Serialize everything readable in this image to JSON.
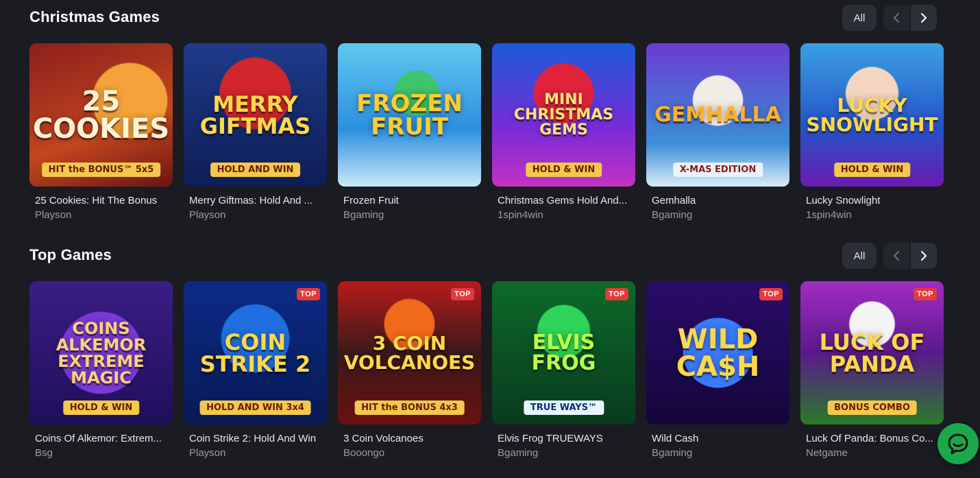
{
  "sections": [
    {
      "title": "Christmas Games",
      "all_label": "All",
      "games": [
        {
          "name": "25 Cookies: Hit The Bonus",
          "provider": "Playson",
          "art_title": "25\nCookies",
          "art_sub": "HIT the BONUS™ 5x5",
          "badge": ""
        },
        {
          "name": "Merry Giftmas: Hold And ...",
          "provider": "Playson",
          "art_title": "Merry\nGiftmas",
          "art_sub": "HOLD AND WIN",
          "badge": ""
        },
        {
          "name": "Frozen Fruit",
          "provider": "Bgaming",
          "art_title": "Frozen\nFruit",
          "art_sub": "",
          "badge": ""
        },
        {
          "name": "Christmas Gems Hold And...",
          "provider": "1spin4win",
          "art_title": "Mini\nChristmas Gems",
          "art_sub": "HOLD & WIN",
          "badge": ""
        },
        {
          "name": "Gemhalla",
          "provider": "Bgaming",
          "art_title": "Gemhalla",
          "art_sub": "X-MAS EDITION",
          "badge": ""
        },
        {
          "name": "Lucky Snowlight",
          "provider": "1spin4win",
          "art_title": "Lucky\nSnowlight",
          "art_sub": "HOLD & WIN",
          "badge": ""
        }
      ]
    },
    {
      "title": "Top Games",
      "all_label": "All",
      "games": [
        {
          "name": "Coins Of Alkemor: Extrem...",
          "provider": "Bsg",
          "art_title": "Coins\nAlkemor\nExtreme Magic",
          "art_sub": "HOLD & WIN",
          "badge": ""
        },
        {
          "name": "Coin Strike 2: Hold And Win",
          "provider": "Playson",
          "art_title": "Coin\nStrike 2",
          "art_sub": "HOLD AND WIN 3x4",
          "badge": "TOP"
        },
        {
          "name": "3 Coin Volcanoes",
          "provider": "Booongo",
          "art_title": "3 Coin\nVolcanoes",
          "art_sub": "HIT the BONUS 4x3",
          "badge": "TOP"
        },
        {
          "name": "Elvis Frog TRUEWAYS",
          "provider": "Bgaming",
          "art_title": "Elvis Frog",
          "art_sub": "TRUE WAYS™",
          "badge": "TOP"
        },
        {
          "name": "Wild Cash",
          "provider": "Bgaming",
          "art_title": "Wild\nCa$h",
          "art_sub": "",
          "badge": "TOP"
        },
        {
          "name": "Luck Of Panda: Bonus Co...",
          "provider": "Netgame",
          "art_title": "Luck of\nPanda",
          "art_sub": "BONUS COMBO",
          "badge": "TOP"
        }
      ]
    }
  ],
  "colors": {
    "background": "#1b1c22",
    "control_bg": "#2c2e36",
    "badge": "#e23b3b",
    "chat": "#1aa84a"
  },
  "icons": {
    "prev": "chevron-left-icon",
    "next": "chevron-right-icon",
    "chat": "chat-bubble-icon"
  }
}
